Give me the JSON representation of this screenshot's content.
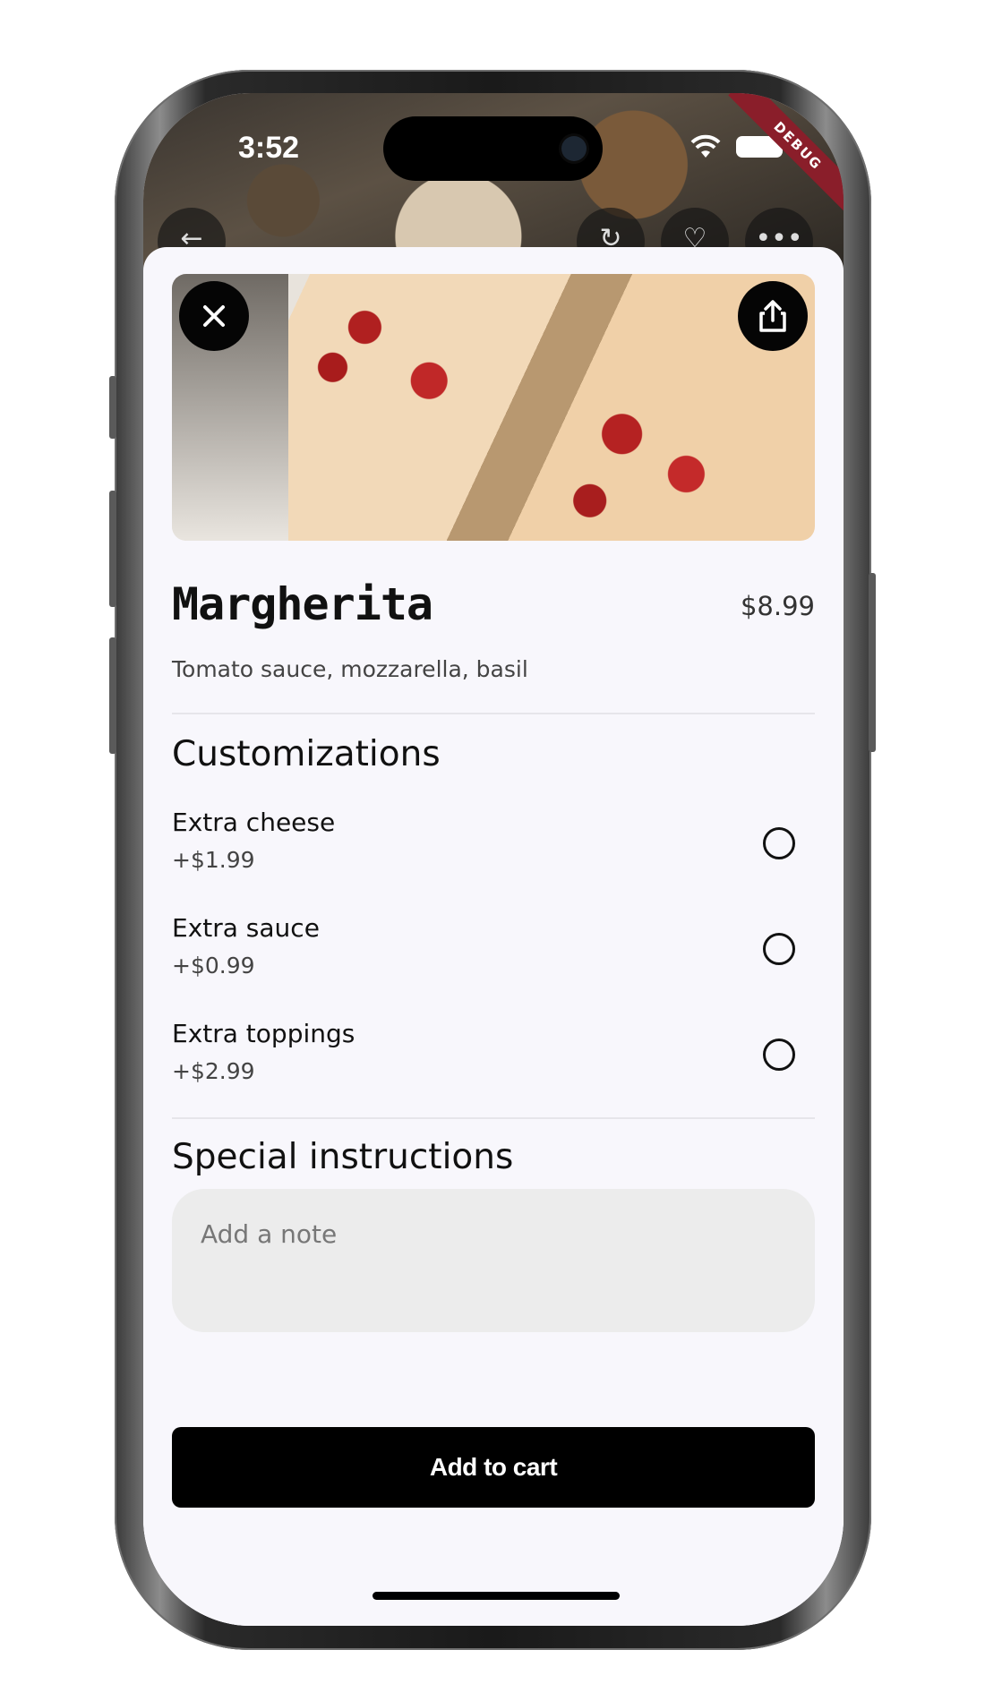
{
  "status_bar": {
    "time": "3:52"
  },
  "debug_banner": "DEBUG",
  "item": {
    "name": "Margherita",
    "price": "$8.99",
    "description": "Tomato sauce, mozzarella, basil"
  },
  "customizations": {
    "title": "Customizations",
    "options": [
      {
        "label": "Extra cheese",
        "price": "+$1.99",
        "selected": false
      },
      {
        "label": "Extra sauce",
        "price": "+$0.99",
        "selected": false
      },
      {
        "label": "Extra toppings",
        "price": "+$2.99",
        "selected": false
      }
    ]
  },
  "special_instructions": {
    "title": "Special instructions",
    "placeholder": "Add a note"
  },
  "cart_button": "Add to cart",
  "icons": {
    "close": "close-icon",
    "share": "share-icon",
    "back": "back-arrow-icon",
    "refresh": "refresh-icon",
    "favorite": "heart-icon",
    "more": "more-icon"
  }
}
